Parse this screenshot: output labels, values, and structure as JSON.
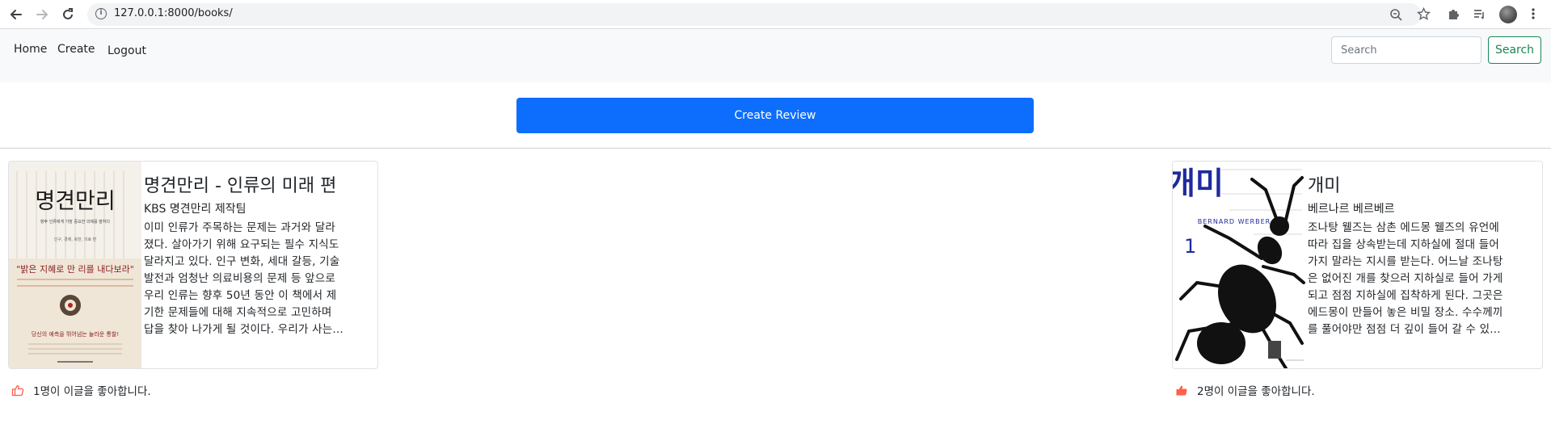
{
  "browser": {
    "url": "127.0.0.1:8000/books/",
    "icons": [
      "back-arrow-icon",
      "forward-arrow-icon",
      "reload-icon",
      "site-info-icon",
      "zoom-icon",
      "bookmark-star-icon",
      "extensions-puzzle-icon",
      "reading-list-icon",
      "profile-avatar",
      "kebab-menu-icon"
    ]
  },
  "navbar": {
    "home": "Home",
    "create": "Create",
    "logout": "Logout",
    "search_placeholder": "Search",
    "search_button": "Search"
  },
  "create_review_button": "Create Review",
  "books": [
    {
      "title": "명견만리 - 인류의 미래 편",
      "author": "KBS 명견만리 제작팀",
      "description_lines": [
        "이미 인류가 주목하는 문제는 과거와 달라",
        "졌다. 살아가기 위해 요구되는 필수 지식도",
        "달라지고 있다. 인구 변화, 세대 갈등, 기술",
        "발전과 엄청난 의료비용의 문제 등 앞으로",
        "우리 인류는 향후 50년 동안 이 책에서 제",
        "기한 문제들에 대해 지속적으로 고민하며",
        "답을 찾아 나가게 될 것이다. 우리가 사는..."
      ],
      "cover_text": {
        "main": "명견만리",
        "sub": "향후 인류에게 가장 중요한 의제를 말하다",
        "badge": "인구, 경제, 북한, 의료 편",
        "quote": "\"밝은 지혜로 만 리를 내다보라\"",
        "bottom": "당신의 예측을 뛰어넘는 놀라운 통찰!"
      },
      "likes": "1명이 이글을 좋아합니다."
    },
    {
      "title": "개미",
      "author": "베르나르 베르베르",
      "description_lines": [
        "조나탕 웰즈는 삼촌 에드몽 웰즈의 유언에",
        "따라 집을 상속받는데 지하실에 절대 들어",
        "가지 말라는 지시를 받는다. 어느날 조나탕",
        "은 없어진 개를 찾으러 지하실로 들어 가게",
        "되고 점점 지하실에 집착하게 된다. 그곳은",
        "에드몽이 만들어 놓은 비밀 장소. 수수께끼",
        "를 풀어야만 점점 더 깊이 들어 갈 수 있..."
      ],
      "cover_text": {
        "main": "개미",
        "sub": "BERNARD WERBER",
        "volume": "1"
      },
      "likes": "2명이 이글을 좋아합니다."
    }
  ],
  "colors": {
    "primary": "#0d6efd",
    "success": "#198754",
    "like": "#ff5f4a"
  }
}
